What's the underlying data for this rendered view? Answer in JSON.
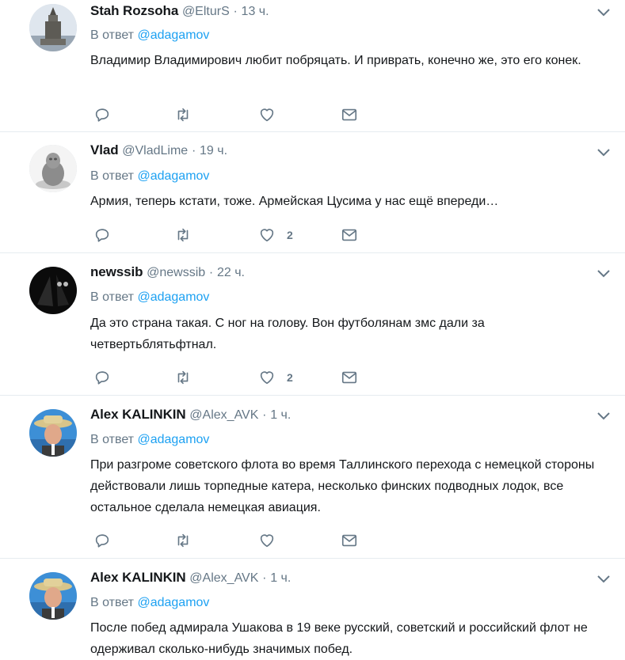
{
  "colors": {
    "accent": "#1da1f2",
    "muted": "#657786",
    "text": "#14171a",
    "divider": "#e6ecf0"
  },
  "tweets": [
    {
      "name": "Stah Rozsoha",
      "handle": "@ElturS",
      "dot": "·",
      "time": "13 ч.",
      "reply_prefix": "В ответ",
      "reply_mention": "@adagamov",
      "text": "Владимир Владимирович любит побряцать. И приврать, конечно же, это его конек.",
      "like_count": "",
      "avatar_icon": "monument-avatar"
    },
    {
      "name": "Vlad",
      "handle": "@VladLime",
      "dot": "·",
      "time": "19 ч.",
      "reply_prefix": "В ответ",
      "reply_mention": "@adagamov",
      "text": "Армия, теперь кстати, тоже. Армейская Цусима у нас ещё впереди…",
      "like_count": "2",
      "avatar_icon": "sculpture-avatar"
    },
    {
      "name": "newssib",
      "handle": "@newssib",
      "dot": "·",
      "time": "22 ч.",
      "reply_prefix": "В ответ",
      "reply_mention": "@adagamov",
      "text": "Да это страна такая. С ног на голову. Вон футболянам змс дали за четвертьблятьфтнал.",
      "like_count": "2",
      "avatar_icon": "dark-avatar"
    },
    {
      "name": "Alex KALINKIN",
      "handle": "@Alex_AVK",
      "dot": "·",
      "time": "1 ч.",
      "reply_prefix": "В ответ",
      "reply_mention": "@adagamov",
      "text": "При разгроме советского флота во время Таллинского перехода с немецкой стороны действовали лишь торпедные катера, несколько финских подводных лодок, все остальное сделала немецкая авиация.",
      "like_count": "",
      "avatar_icon": "hat-man-avatar"
    },
    {
      "name": "Alex KALINKIN",
      "handle": "@Alex_AVK",
      "dot": "·",
      "time": "1 ч.",
      "reply_prefix": "В ответ",
      "reply_mention": "@adagamov",
      "text": "После побед адмирала Ушакова в 19 веке русский, советский и российский флот не одерживал сколько-нибудь значимых побед.",
      "like_count": "",
      "avatar_icon": "hat-man-avatar"
    }
  ]
}
